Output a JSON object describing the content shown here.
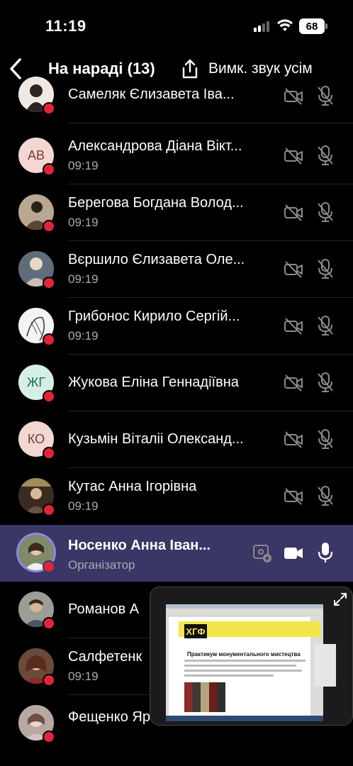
{
  "status_bar": {
    "time": "11:19",
    "battery": "68"
  },
  "header": {
    "title": "На нараді (13)",
    "mute_all": "Вимк. звук усім"
  },
  "participants": [
    {
      "name": "Самеляк  Єлизавета  Іва...",
      "time": "",
      "avatar": "photo"
    },
    {
      "name": "Александрова Діана Вікт...",
      "time": "09:19",
      "avatar": "initials",
      "initials": "АВ"
    },
    {
      "name": "Берегова Богдана Волод...",
      "time": "09:19",
      "avatar": "photo"
    },
    {
      "name": "Вєршило Єлизавета Оле...",
      "time": "09:19",
      "avatar": "photo"
    },
    {
      "name": "Грибонос Кирило Сергій...",
      "time": "09:19",
      "avatar": "photo"
    },
    {
      "name": "Жукова Еліна Геннадіївна",
      "time": "",
      "avatar": "initials",
      "initials": "ЖГ"
    },
    {
      "name": "Кузьмін Віталіі Олександ...",
      "time": "",
      "avatar": "initials",
      "initials": "КО"
    },
    {
      "name": "Кутас Анна Ігорівна",
      "time": "09:19",
      "avatar": "photo"
    },
    {
      "name": "Носенко Анна Іван...",
      "role": "Організатор",
      "avatar": "photo",
      "organizer": true
    },
    {
      "name": "Романов А",
      "time": "",
      "avatar": "photo"
    },
    {
      "name": "Салфетенк",
      "time": "09:19",
      "avatar": "photo"
    },
    {
      "name": "Фещенко Яр",
      "time": "",
      "avatar": "photo"
    }
  ],
  "share_preview": {
    "logo": "ХГФ",
    "doc_title": "Практикум монументального мистецтва"
  },
  "colors": {
    "status_red": "#e0243a",
    "organizer_bg": "#3a3666",
    "ring": "#8f86e6"
  }
}
